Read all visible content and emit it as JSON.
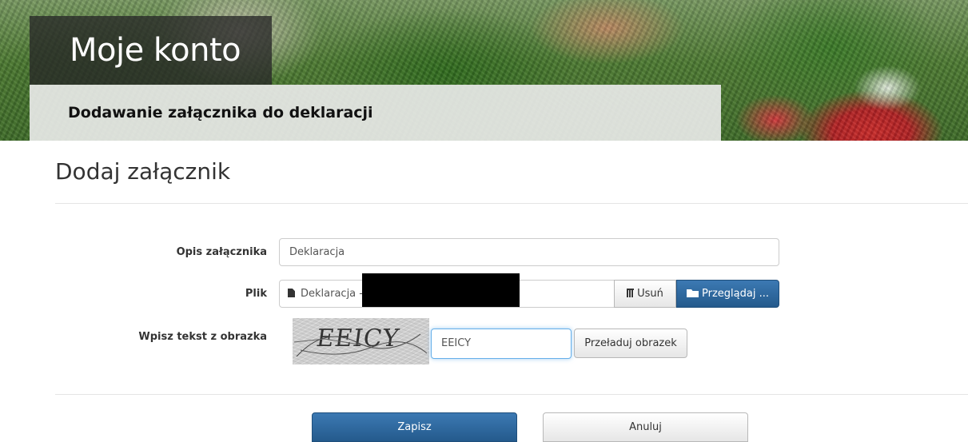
{
  "header": {
    "title": "Moje konto",
    "subtitle": "Dodawanie załącznika do deklaracji"
  },
  "page": {
    "title": "Dodaj załącznik"
  },
  "form": {
    "description_label": "Opis załącznika",
    "description_value": "Deklaracja",
    "file_label": "Plik",
    "file_value": "Deklaracja -",
    "file_icon": "file-icon",
    "remove_label": "Usuń",
    "remove_icon": "trash-icon",
    "browse_label": "Przeglądaj ...",
    "browse_icon": "folder-open-icon",
    "captcha_label": "Wpisz tekst z obrazka",
    "captcha_image_text": "EEICY",
    "captcha_value": "EEICY",
    "reload_label": "Przeładuj obrazek"
  },
  "actions": {
    "save_label": "Zapisz",
    "cancel_label": "Anuluj"
  },
  "colors": {
    "primary": "#2a6399",
    "focus_border": "#66afe9"
  }
}
